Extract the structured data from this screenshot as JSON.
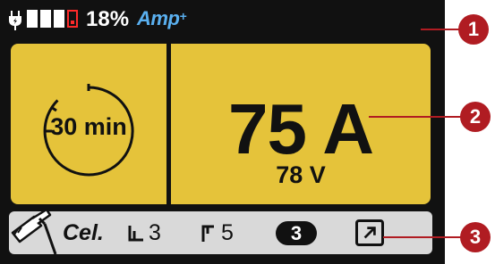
{
  "status_bar": {
    "battery_percent": "18%",
    "mode_label": "Amp",
    "mode_suffix": "+",
    "battery_bars": [
      "full",
      "full",
      "full",
      "low"
    ]
  },
  "timer_panel": {
    "remaining": "30 min"
  },
  "current_panel": {
    "current": "75 A",
    "voltage": "78 V"
  },
  "settings_bar": {
    "electrode_type": "Cel.",
    "hot_start_value": "3",
    "arc_force_value": "5",
    "program_number": "3",
    "vrd_icon": "arrow-up-right-icon"
  },
  "callouts": [
    "1",
    "2",
    "3"
  ],
  "colors": {
    "panel": "#e5c33a",
    "screen": "#111111",
    "bar": "#d9d9d9",
    "amp_accent": "#5ab0f0",
    "callout": "#b01c22",
    "battery_low": "#ff2a2a"
  }
}
